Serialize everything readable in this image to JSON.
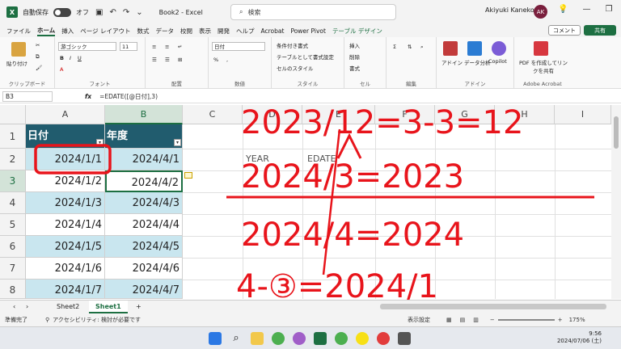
{
  "titlebar": {
    "app_icon": "X",
    "autosave_label": "自動保存",
    "autosave_state": "オフ",
    "doc_title": "Book2 - Excel",
    "search_placeholder": "検索",
    "user_name": "Akiyuki Kaneko",
    "avatar_initials": "AK"
  },
  "menu": {
    "items": [
      "ファイル",
      "ホーム",
      "挿入",
      "ページ レイアウト",
      "数式",
      "データ",
      "校閲",
      "表示",
      "開発",
      "ヘルプ",
      "Acrobat",
      "Power Pivot",
      "テーブル デザイン"
    ],
    "active_index": 1,
    "comment_label": "コメント",
    "share_label": "共有"
  },
  "ribbon": {
    "clipboard": {
      "label": "クリップボード",
      "paste": "貼り付け"
    },
    "font": {
      "label": "フォント",
      "name": "游ゴシック",
      "size": "11"
    },
    "alignment": {
      "label": "配置"
    },
    "number": {
      "label": "数値",
      "format": "日付"
    },
    "styles": {
      "label": "スタイル",
      "conditional": "条件付き書式",
      "as_table": "テーブルとして書式設定",
      "cell_styles": "セルのスタイル"
    },
    "cells": {
      "label": "セル",
      "insert": "挿入",
      "delete": "削除",
      "format": "書式"
    },
    "editing": {
      "label": "編集"
    },
    "addins": {
      "label": "アドイン",
      "addin": "アドイン",
      "data_analysis": "データ分析",
      "copilot": "Copilot"
    },
    "acrobat": {
      "label": "Adobe Acrobat",
      "pdf": "PDF を作成してリンクを共有"
    }
  },
  "formula_bar": {
    "name_box": "B3",
    "fx": "fx",
    "formula": "=EDATE([@日付],3)"
  },
  "columns": [
    "A",
    "B",
    "C",
    "D",
    "E",
    "F",
    "G",
    "H",
    "I"
  ],
  "selected_column": "B",
  "rows": [
    "1",
    "2",
    "3",
    "4",
    "5",
    "6",
    "7",
    "8"
  ],
  "selected_row": "3",
  "table": {
    "header": [
      "日付",
      "年度"
    ],
    "rows": [
      [
        "2024/1/1",
        "2024/4/1"
      ],
      [
        "2024/1/2",
        "2024/4/2"
      ],
      [
        "2024/1/3",
        "2024/4/3"
      ],
      [
        "2024/1/4",
        "2024/4/4"
      ],
      [
        "2024/1/5",
        "2024/4/5"
      ],
      [
        "2024/1/6",
        "2024/4/6"
      ],
      [
        "2024/1/7",
        "2024/4/7"
      ]
    ]
  },
  "other_cells": {
    "d2": "YEAR",
    "e2": "EDATE"
  },
  "annotations": {
    "color": "#e8141b",
    "line1": "2023/12=3-3=12",
    "line2": "2024/3=2023",
    "line3": "2024/4=2024",
    "line4": "4-③=2024/1"
  },
  "sheets": [
    "Sheet2",
    "Sheet1"
  ],
  "active_sheet": "Sheet1",
  "status": {
    "ready": "準備完了",
    "accessibility": "アクセシビリティ: 検討が必要です",
    "display_settings": "表示設定",
    "zoom": "175%"
  },
  "taskbar": {
    "time": "9:56",
    "date": "2024/07/06 (土)"
  },
  "colors": {
    "excel_green": "#1d6f42",
    "table_header": "#215c6e",
    "table_band": "#c9e6ef"
  }
}
